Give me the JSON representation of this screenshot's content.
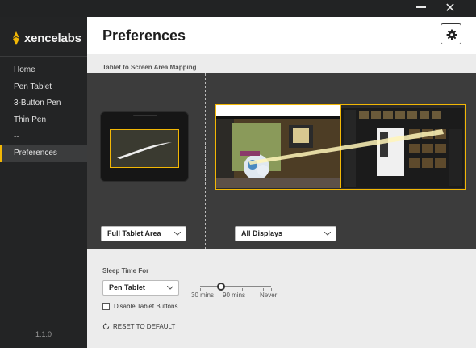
{
  "window": {
    "minimize_icon": "minimize-icon",
    "close_glyph": "✕"
  },
  "sidebar": {
    "logo_text": "xencelabs",
    "items": [
      {
        "label": "Home"
      },
      {
        "label": "Pen Tablet"
      },
      {
        "label": "3-Button Pen"
      },
      {
        "label": "Thin Pen"
      },
      {
        "label": "--"
      },
      {
        "label": "Preferences",
        "active": true
      }
    ],
    "version": "1.1.0"
  },
  "header": {
    "title": "Preferences",
    "settings_icon": "gear-icon"
  },
  "mapping": {
    "label": "Tablet to Screen Area Mapping",
    "tablet_area": "Full Tablet Area",
    "displays": "All Displays"
  },
  "sleep": {
    "label": "Sleep Time For",
    "device": "Pen Tablet",
    "slider_labels": [
      "30 mins",
      "90 mins",
      "Never"
    ],
    "slider_position": "30 mins"
  },
  "disable_buttons": {
    "label": "Disable Tablet Buttons",
    "checked": false
  },
  "reset": {
    "label": "RESET TO DEFAULT"
  },
  "colors": {
    "accent": "#f2b705",
    "sidebar_bg": "#232425",
    "content_bg": "#ececec"
  }
}
